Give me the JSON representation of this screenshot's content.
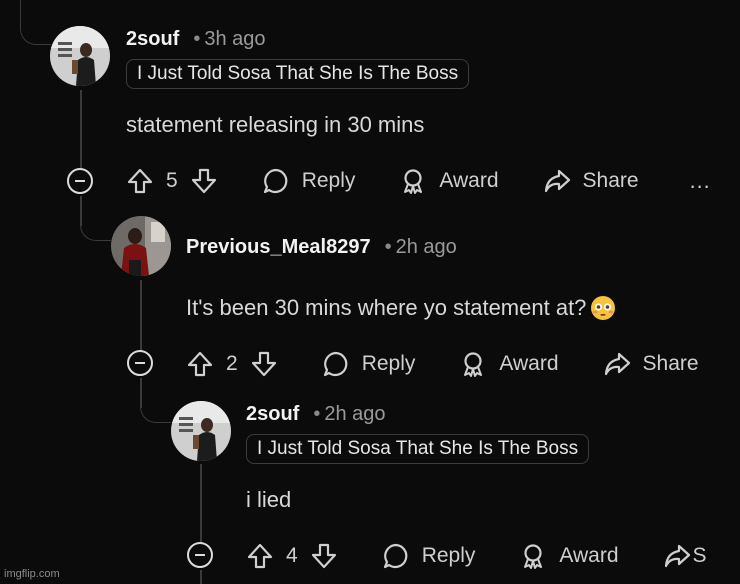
{
  "comments": [
    {
      "username": "2souf",
      "dot": "•",
      "time": "3h ago",
      "flair": "I Just Told Sosa That She Is The Boss",
      "body": "statement releasing in 30 mins",
      "votes": "5",
      "reply_label": "Reply",
      "award_label": "Award",
      "share_label": "Share",
      "more_label": "…"
    },
    {
      "username": "Previous_Meal8297",
      "dot": "•",
      "time": "2h ago",
      "body": "It's been 30 mins where yo statement at?",
      "emoji": "flushed-face",
      "votes": "2",
      "reply_label": "Reply",
      "award_label": "Award",
      "share_label": "Share"
    },
    {
      "username": "2souf",
      "dot": "•",
      "time": "2h ago",
      "flair": "I Just Told Sosa That She Is The Boss",
      "body": "i lied",
      "votes": "4",
      "reply_label": "Reply",
      "award_label": "Award",
      "share_label": "S"
    }
  ],
  "watermark": "imgflip.com",
  "colors": {
    "background": "#0b0b0b",
    "thread_line": "#3a3a3a",
    "text": "#d8d8d8"
  }
}
